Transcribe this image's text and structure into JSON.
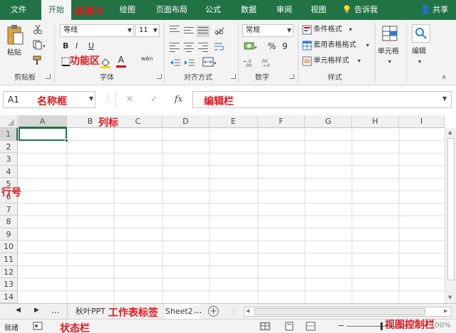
{
  "tabs": [
    {
      "label": "文件",
      "active": false
    },
    {
      "label": "开始",
      "active": true
    },
    {
      "label": "绘图",
      "active": false
    },
    {
      "label": "页面布局",
      "active": false
    },
    {
      "label": "公式",
      "active": false
    },
    {
      "label": "数据",
      "active": false
    },
    {
      "label": "审阅",
      "active": false
    },
    {
      "label": "视图",
      "active": false
    }
  ],
  "tell_me": "告诉我",
  "share": "共享",
  "ribbon": {
    "clipboard": {
      "paste_label": "粘贴",
      "group_label": "剪贴板"
    },
    "font": {
      "font_name": "等线",
      "font_size": "11",
      "bold": "B",
      "italic": "I",
      "underline": "U",
      "font_color_letter": "A",
      "phonetic": "wén",
      "group_label": "字体"
    },
    "alignment": {
      "group_label": "对齐方式"
    },
    "number": {
      "format": "常规",
      "percent": "%",
      "comma": "9",
      "group_label": "数字"
    },
    "styles": {
      "conditional": "条件格式",
      "table_format": "套用表格格式",
      "cell_styles": "单元格样式",
      "group_label": "样式"
    },
    "cells": {
      "label": "单元格"
    },
    "editing": {
      "label": "编辑"
    }
  },
  "formula_bar": {
    "name_box": "A1",
    "cancel": "✕",
    "enter": "✓",
    "fx": "fx",
    "value": ""
  },
  "grid": {
    "columns": [
      "A",
      "B",
      "C",
      "D",
      "E",
      "F",
      "G",
      "H",
      "I"
    ],
    "rows": [
      "1",
      "2",
      "3",
      "4",
      "5",
      "6",
      "7",
      "8",
      "9",
      "10",
      "11",
      "12",
      "13",
      "14"
    ],
    "selected_cell": "A1"
  },
  "sheets": {
    "ellipsis": "...",
    "tabs": [
      "秋叶PPT",
      "Sheet2"
    ],
    "active": "Sheet2",
    "add": "+"
  },
  "status": {
    "ready": "就绪",
    "zoom": "100%"
  },
  "annotations": {
    "tab_bar": "选项卡",
    "ribbon": "功能区",
    "name_box": "名称框",
    "formula_bar": "编辑栏",
    "col_header": "列标",
    "row_header": "行号",
    "sheet_tabs": "工作表标签",
    "status_bar": "状态栏",
    "view_controls": "视图控制栏"
  },
  "colors": {
    "accent": "#217346",
    "annotation": "#e0181e"
  }
}
